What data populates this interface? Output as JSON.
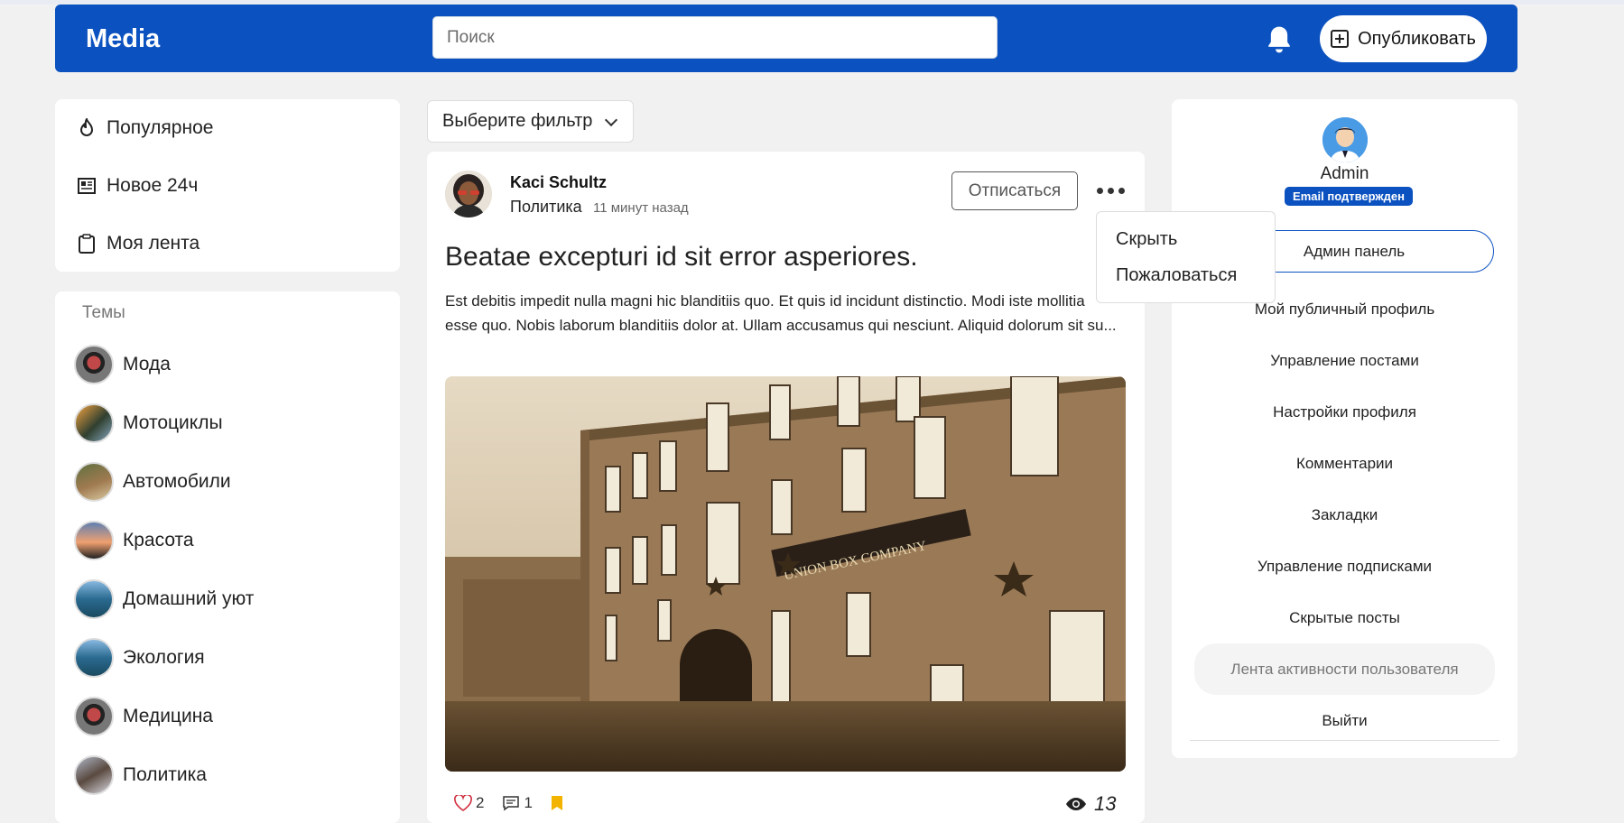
{
  "header": {
    "logo": "Media",
    "search_placeholder": "Поиск",
    "bell_icon": "bell-icon",
    "publish_label": "Опубликовать",
    "color": "#0b52c0"
  },
  "left_nav": {
    "items": [
      {
        "label": "Популярное",
        "icon": "fire-icon"
      },
      {
        "label": "Новое 24ч",
        "icon": "newspaper-icon"
      },
      {
        "label": "Моя лента",
        "icon": "clipboard-icon"
      }
    ]
  },
  "topics": {
    "title": "Темы",
    "items": [
      {
        "label": "Мода"
      },
      {
        "label": "Мотоциклы"
      },
      {
        "label": "Автомобили"
      },
      {
        "label": "Красота"
      },
      {
        "label": "Домашний уют"
      },
      {
        "label": "Экология"
      },
      {
        "label": "Медицина"
      },
      {
        "label": "Политика"
      }
    ]
  },
  "filter": {
    "label": "Выберите фильтр"
  },
  "post": {
    "author": "Kaci Schultz",
    "category": "Политика",
    "time": "11 минут назад",
    "unsubscribe_label": "Отписаться",
    "title": "Beatae excepturi id sit error asperiores.",
    "body": "Est debitis impedit nulla magni hic blanditiis quo. Et quis id incidunt distinctio. Modi iste mollitia esse quo. Nobis laborum blanditiis dolor at. Ullam accusamus qui nesciunt. Aliquid dolorum sit su...",
    "image_sign": "UNION BOX COMPANY",
    "likes": "2",
    "comments": "1",
    "views": "13"
  },
  "post_menu": {
    "items": [
      "Скрыть",
      "Пожаловаться"
    ]
  },
  "profile": {
    "name": "Admin",
    "badge": "Email подтвержден",
    "admin_panel": "Админ панель",
    "menu": [
      "Мой публичный профиль",
      "Управление постами",
      "Настройки профиля",
      "Комментарии",
      "Закладки",
      "Управление подписками",
      "Скрытые посты",
      "Лента активности пользователя",
      "Выйти"
    ]
  }
}
